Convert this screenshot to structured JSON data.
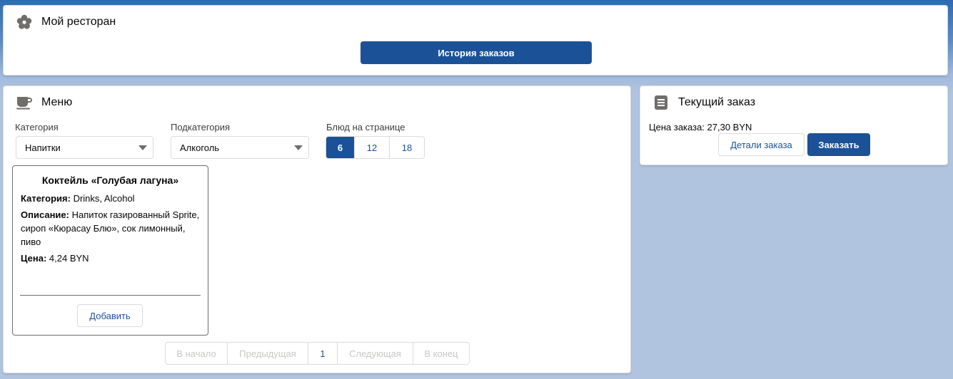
{
  "restaurant": {
    "title": "Мой ресторан",
    "icon": "flower-icon",
    "history_button": "История заказов"
  },
  "menu": {
    "title": "Меню",
    "icon": "coffee-cup-icon",
    "category": {
      "label": "Категория",
      "value": "Напитки"
    },
    "subcategory": {
      "label": "Подкатегория",
      "value": "Алкоголь"
    },
    "per_page": {
      "label": "Блюд на странице",
      "options": [
        "6",
        "12",
        "18"
      ],
      "selected": "6"
    },
    "dishes": [
      {
        "title": "Коктейль «Голубая лагуна»",
        "category_label": "Категория:",
        "category_value": "Drinks, Alcohol",
        "description_label": "Описание:",
        "description_value": "Напиток газированный Sprite, сироп «Кюрасау Блю», сок лимонный, пиво",
        "price_label": "Цена:",
        "price_value": "4,24 BYN",
        "add_button": "Добавить"
      }
    ],
    "pagination": {
      "first": "В начало",
      "prev": "Предыдущая",
      "current": "1",
      "next": "Следующая",
      "last": "В конец"
    }
  },
  "order": {
    "title": "Текущий заказ",
    "icon": "document-list-icon",
    "price_text": "Цена заказа: 27,30 BYN",
    "details_button": "Детали заказа",
    "order_button": "Заказать"
  },
  "colors": {
    "brand": "#1b5297",
    "page_bg": "#b0c4df",
    "border": "#dddbda",
    "disabled_text": "#c9c7c5"
  }
}
